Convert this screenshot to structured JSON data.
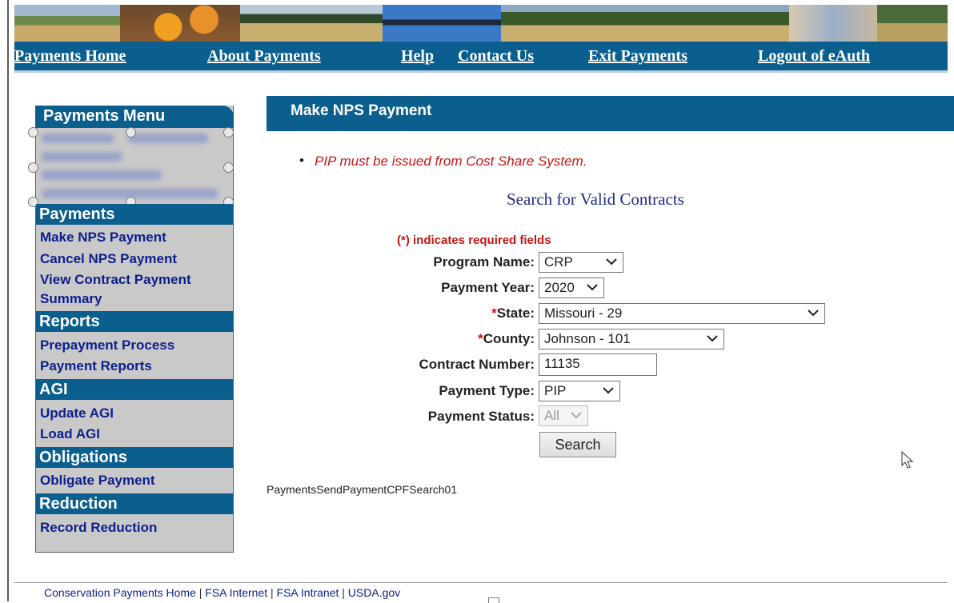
{
  "nav": {
    "links": [
      "Payments Home",
      "About Payments",
      "Help",
      "Contact Us",
      "Exit Payments",
      "Logout of eAuth"
    ]
  },
  "sidebar": {
    "menu_title": "Payments Menu",
    "sections": [
      {
        "title": "Payments",
        "items": [
          "Make NPS Payment",
          "Cancel NPS Payment",
          "View Contract Payment",
          "Summary"
        ]
      },
      {
        "title": "Reports",
        "items": [
          "Prepayment Process",
          "Payment Reports"
        ]
      },
      {
        "title": "AGI",
        "items": [
          "Update AGI",
          "Load AGI"
        ]
      },
      {
        "title": "Obligations",
        "items": [
          "Obligate Payment"
        ]
      },
      {
        "title": "Reduction",
        "items": [
          "Record Reduction"
        ]
      }
    ]
  },
  "main": {
    "title": "Make NPS Payment",
    "notice": "PIP must be issued from Cost Share System.",
    "search_title": "Search for Valid Contracts",
    "required_note": "(*) indicates required fields",
    "form": {
      "program_name": {
        "label": "Program Name:",
        "value": "CRP"
      },
      "payment_year": {
        "label": "Payment Year:",
        "value": "2020"
      },
      "state": {
        "star": "*",
        "label": "State:",
        "value": "Missouri - 29"
      },
      "county": {
        "star": "*",
        "label": "County:",
        "value": "Johnson - 101"
      },
      "contract_number": {
        "label": "Contract Number:",
        "value": "11135"
      },
      "payment_type": {
        "label": "Payment Type:",
        "value": "PIP"
      },
      "payment_status": {
        "label": "Payment Status:",
        "value": "All"
      }
    },
    "search_button": "Search",
    "page_code": "PaymentsSendPaymentCPFSearch01"
  },
  "footer": {
    "links": [
      "Conservation Payments Home",
      "FSA Internet",
      "FSA Intranet",
      "USDA.gov"
    ],
    "separator": "|"
  },
  "colors": {
    "brand": "#0a5f8f",
    "link": "#0c1f8c",
    "required": "#c41616"
  },
  "icons": [
    "chevron-down-icon",
    "mouse-cursor-icon",
    "bullet-icon"
  ]
}
